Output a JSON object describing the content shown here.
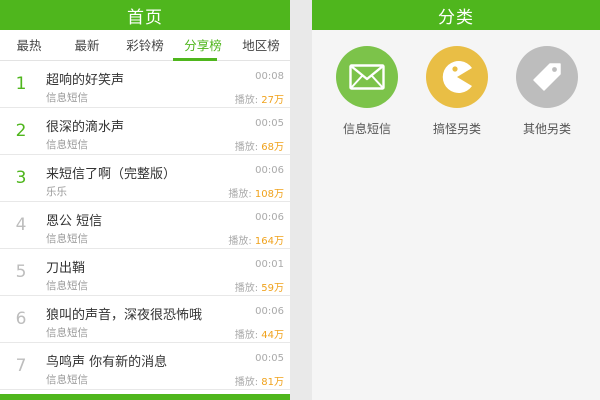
{
  "left": {
    "title": "首页",
    "tabs": [
      {
        "label": "最热"
      },
      {
        "label": "最新"
      },
      {
        "label": "彩铃榜"
      },
      {
        "label": "分享榜",
        "active": true
      },
      {
        "label": "地区榜"
      }
    ],
    "items": [
      {
        "rank": "1",
        "title": "超响的好笑声",
        "category": "信息短信",
        "duration": "00:08",
        "plays_label": "播放:",
        "plays": "27万"
      },
      {
        "rank": "2",
        "title": "很深的滴水声",
        "category": "信息短信",
        "duration": "00:05",
        "plays_label": "播放:",
        "plays": "68万"
      },
      {
        "rank": "3",
        "title": "来短信了啊（完整版）",
        "category": "乐乐",
        "duration": "00:06",
        "plays_label": "播放:",
        "plays": "108万"
      },
      {
        "rank": "4",
        "title": "恩公 短信",
        "category": "信息短信",
        "duration": "00:06",
        "plays_label": "播放:",
        "plays": "164万"
      },
      {
        "rank": "5",
        "title": "刀出鞘",
        "category": "信息短信",
        "duration": "00:01",
        "plays_label": "播放:",
        "plays": "59万"
      },
      {
        "rank": "6",
        "title": "狼叫的声音，深夜很恐怖哦",
        "category": "信息短信",
        "duration": "00:06",
        "plays_label": "播放:",
        "plays": "44万"
      },
      {
        "rank": "7",
        "title": "鸟鸣声 你有新的消息",
        "category": "信息短信",
        "duration": "00:05",
        "plays_label": "播放:",
        "plays": "81万"
      }
    ]
  },
  "right": {
    "title": "分类",
    "categories": [
      {
        "label": "信息短信",
        "icon": "envelope-icon",
        "color": "#7cc34a"
      },
      {
        "label": "搞怪另类",
        "icon": "pacman-icon",
        "color": "#e9be45"
      },
      {
        "label": "其他另类",
        "icon": "tag-icon",
        "color": "#bdbdbd"
      }
    ]
  },
  "colors": {
    "brand": "#4fb61d",
    "accent": "#f0a21c"
  }
}
